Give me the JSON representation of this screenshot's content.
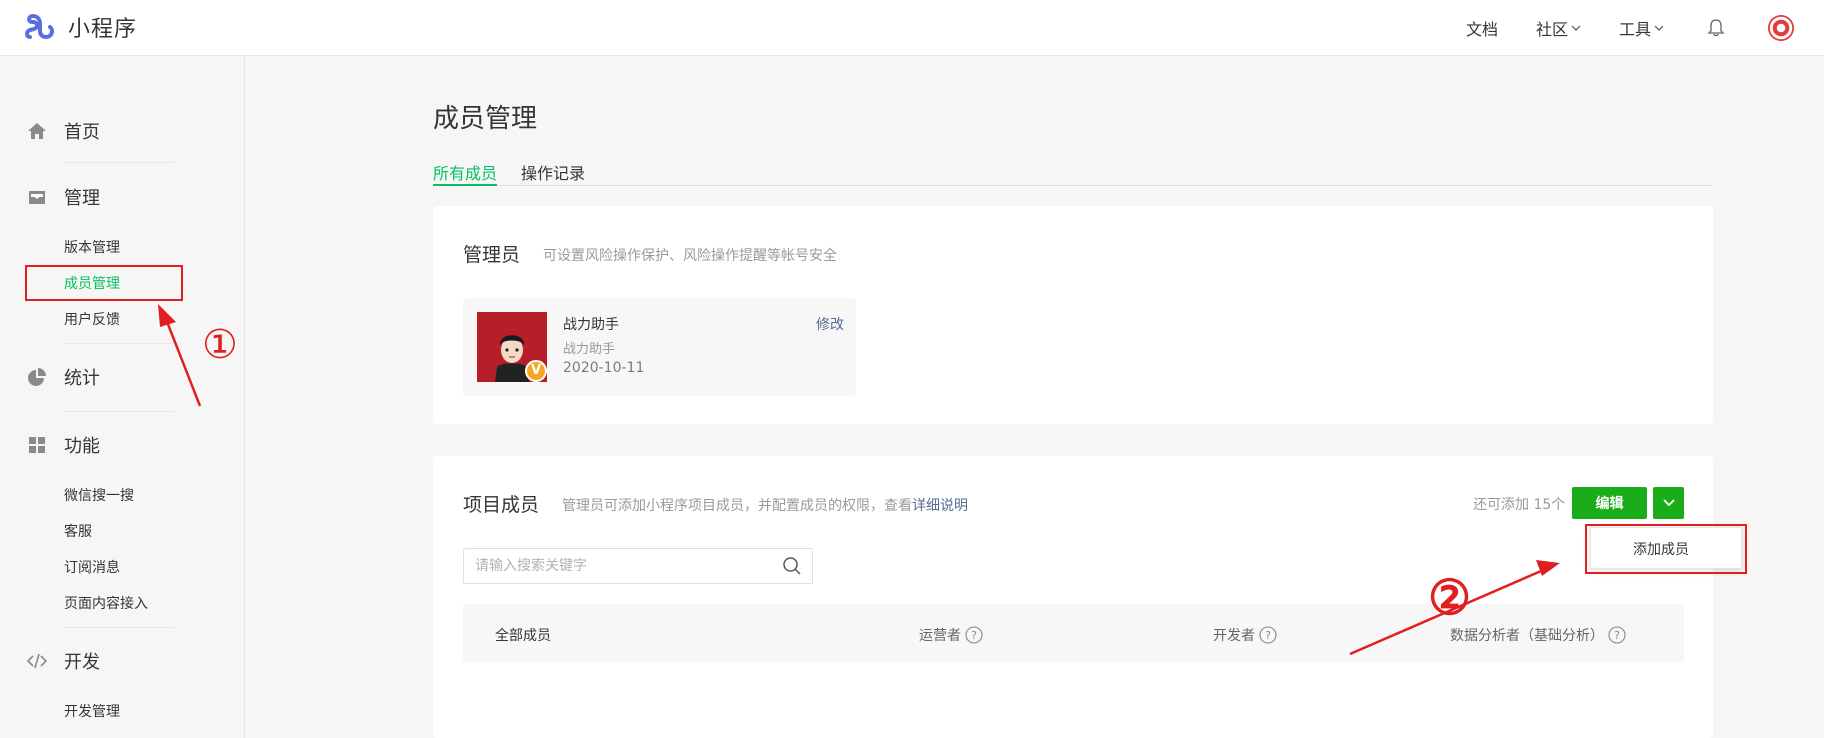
{
  "app": {
    "name": "小程序"
  },
  "topnav": {
    "docs": "文档",
    "community": "社区",
    "tools": "工具"
  },
  "sidebar": {
    "home": "首页",
    "manage": {
      "label": "管理",
      "items": [
        "版本管理",
        "成员管理",
        "用户反馈"
      ]
    },
    "stats": "统计",
    "features": {
      "label": "功能",
      "items": [
        "微信搜一搜",
        "客服",
        "订阅消息",
        "页面内容接入"
      ]
    },
    "dev": {
      "label": "开发",
      "items": [
        "开发管理"
      ]
    }
  },
  "page": {
    "title": "成员管理",
    "tabs": [
      "所有成员",
      "操作记录"
    ]
  },
  "admin": {
    "title": "管理员",
    "desc": "可设置风险操作保护、风险操作提醒等帐号安全",
    "name": "战力助手",
    "sub": "战力助手",
    "date": "2020-10-11",
    "edit": "修改",
    "badge": "V"
  },
  "members": {
    "title": "项目成员",
    "desc": "管理员可添加小程序项目成员，并配置成员的权限，查看",
    "desc_link": "详细说明",
    "remain": "还可添加 15个",
    "edit_button": "编辑",
    "dropdown_item": "添加成员",
    "search_placeholder": "请输入搜索关键字",
    "columns": [
      "全部成员",
      "运营者",
      "开发者",
      "数据分析者（基础分析）"
    ],
    "question_mark": "?"
  },
  "annotations": [
    "①",
    "②"
  ],
  "colors": {
    "accent": "#07c160",
    "button": "#1aad19",
    "link": "#576b95",
    "annotation": "#e02020"
  }
}
